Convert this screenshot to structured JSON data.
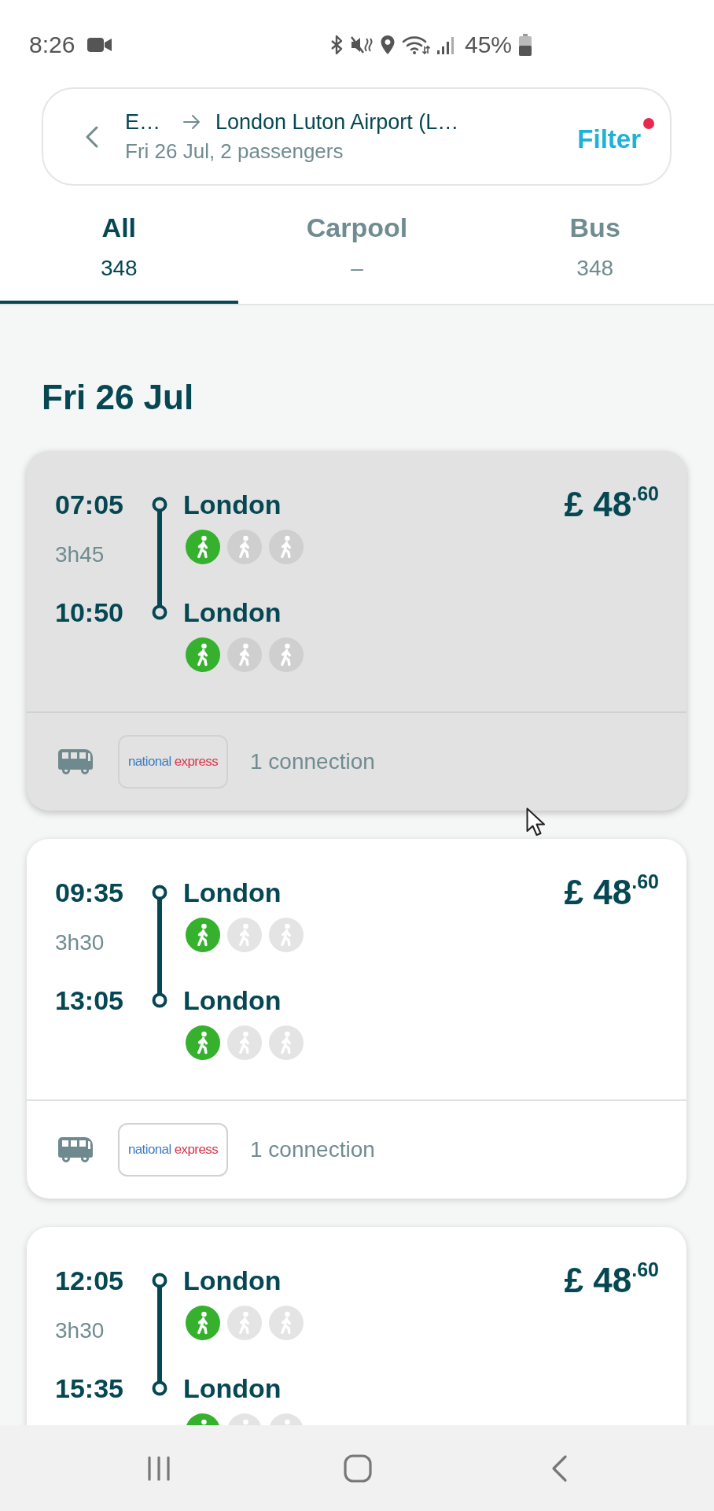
{
  "status_bar": {
    "time": "8:26",
    "battery": "45%"
  },
  "search_summary": {
    "origin": "E…",
    "destination": "London Luton Airport (L…",
    "details": "Fri 26 Jul, 2 passengers",
    "filter_label": "Filter",
    "filter_active": true
  },
  "tabs": [
    {
      "label": "All",
      "count": "348",
      "selected": true
    },
    {
      "label": "Carpool",
      "count": "–",
      "selected": false
    },
    {
      "label": "Bus",
      "count": "348",
      "selected": false
    }
  ],
  "date_heading": "Fri 26 Jul",
  "trips": [
    {
      "highlighted": true,
      "departure": {
        "time": "07:05",
        "city": "London",
        "proximity": [
          {
            "on": true
          },
          {
            "on": false
          },
          {
            "on": false
          }
        ]
      },
      "duration": "3h45",
      "arrival": {
        "time": "10:50",
        "city": "London",
        "proximity": [
          {
            "on": true
          },
          {
            "on": false
          },
          {
            "on": false
          }
        ]
      },
      "price": "£ 48$^{.60}$",
      "operator_logo": [
        "national",
        "express"
      ],
      "connections": "1 connection"
    },
    {
      "highlighted": false,
      "departure": {
        "time": "09:35",
        "city": "London",
        "proximity": [
          {
            "on": true
          },
          {
            "on": false
          },
          {
            "on": false
          }
        ]
      },
      "duration": "3h30",
      "arrival": {
        "time": "13:05",
        "city": "London",
        "proximity": [
          {
            "on": true
          },
          {
            "on": false
          },
          {
            "on": false
          }
        ]
      },
      "price": "£ 48$^{.60}$",
      "operator_logo": [
        "national",
        "express"
      ],
      "connections": "1 connection"
    },
    {
      "highlighted": false,
      "departure": {
        "time": "12:05",
        "city": "London",
        "proximity": [
          {
            "on": true
          },
          {
            "on": false
          },
          {
            "on": false
          }
        ]
      },
      "duration": "3h30",
      "arrival": {
        "time": "15:35",
        "city": "London",
        "proximity": [
          {
            "on": true
          },
          {
            "on": false
          },
          {
            "on": false
          }
        ]
      },
      "price": "£ 48$^{.60}$"
    }
  ]
}
